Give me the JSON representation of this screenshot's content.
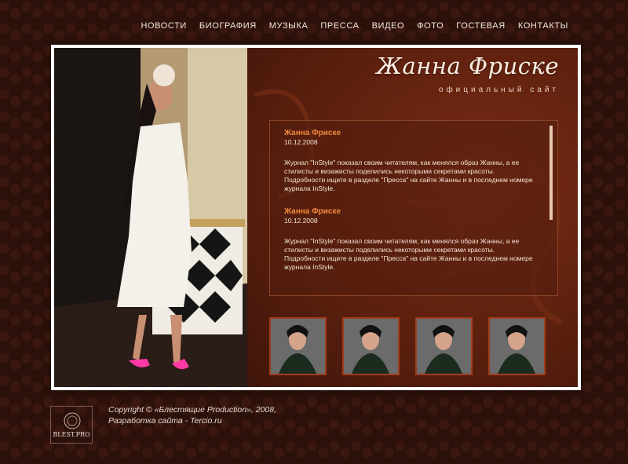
{
  "nav": {
    "items": [
      "НОВОСТИ",
      "БИОГРАФИЯ",
      "МУЗЫКА",
      "ПРЕССА",
      "ВИДЕО",
      "ФОТО",
      "ГОСТЕВАЯ",
      "КОНТАКТЫ"
    ]
  },
  "brand": {
    "title": "Жанна Фриске",
    "subtitle": "официальный сайт"
  },
  "news": [
    {
      "title": "Жанна Фриске",
      "date": "10.12.2008",
      "text": "Журнал \"InStyle\" показал своим читателям, как менялся образ Жанны, а ее стилисты и визажисты поделились некоторыми секретами красоты. Подробности ищите в разделе \"Пресса\" на сайте Жанны и в последнем номере журнала InStyle."
    },
    {
      "title": "Жанна Фриске",
      "date": "10.12.2008",
      "text": "Журнал \"InStyle\" показал своим читателям, как менялся образ Жанны, а ее стилисты и визажисты поделились некоторыми секретами красоты. Подробности ищите в разделе \"Пресса\" на сайте Жанны и в последнем номере журнала InStyle."
    }
  ],
  "thumbnails": [
    "photo-thumbnail",
    "photo-thumbnail",
    "photo-thumbnail",
    "photo-thumbnail"
  ],
  "footer": {
    "logo_text": "BLEST.PRO",
    "copyright_line1": "Copyright © «Блестящие Production», 2008,",
    "copyright_line2": "Разработка сайта - Tercio.ru"
  },
  "colors": {
    "background": "#2b110a",
    "accent": "#f08a3c",
    "panel": "#5c200e"
  }
}
